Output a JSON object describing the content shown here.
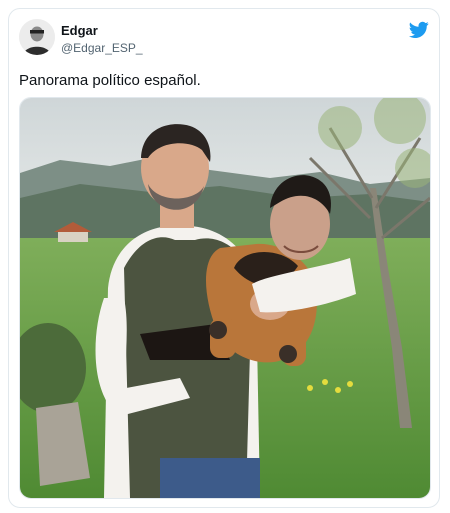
{
  "tweet": {
    "author_name": "Edgar",
    "author_handle": "@Edgar_ESP_",
    "text": "Panorama político español.",
    "logo_icon": "twitter-bird-icon",
    "accent_color": "#1d9bf0"
  }
}
